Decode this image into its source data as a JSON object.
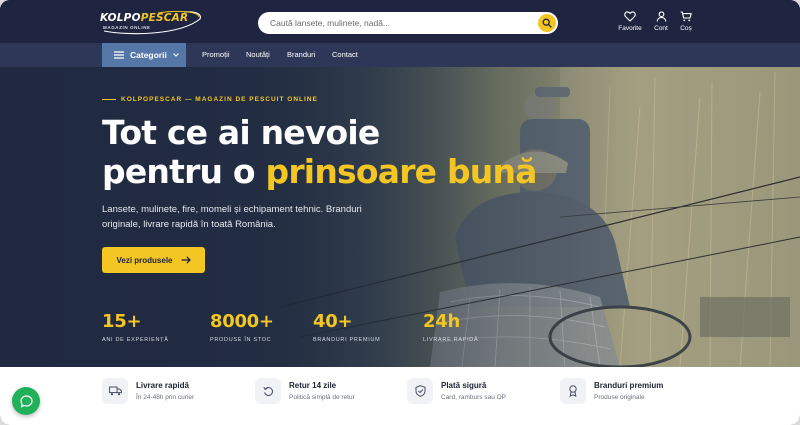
{
  "header": {
    "logo": {
      "name": "KOLPOPESCAR",
      "name_main": "KOLPO",
      "name_accent": "PESCAR",
      "tagline": "MAGAZIN ONLINE"
    },
    "search": {
      "placeholder": "Caută lansete, mulinete, nadă...",
      "icon": "search-icon"
    },
    "actions": [
      {
        "label": "Favorite",
        "icon": "heart-icon"
      },
      {
        "label": "Cont",
        "icon": "user-icon"
      },
      {
        "label": "Coș",
        "icon": "cart-icon"
      }
    ]
  },
  "nav": {
    "categories_label": "Categorii",
    "links": [
      "Promoții",
      "Noutăți",
      "Branduri",
      "Contact"
    ]
  },
  "hero": {
    "eyebrow": "KOLPOPESCAR — MAGAZIN DE PESCUIT ONLINE",
    "headline_line1": "Tot ce ai nevoie",
    "headline_line2_prefix": "pentru o",
    "headline_accent": "prinsoare bună",
    "subtitle": "Lansete, mulinete, fire, momeli și echipament tehnic. Branduri originale, livrare rapidă în toată România.",
    "cta_label": "Vezi produsele",
    "stats": [
      {
        "value": "15+",
        "label": "ANI DE EXPERIENȚĂ"
      },
      {
        "value": "8000+",
        "label": "PRODUSE ÎN STOC"
      },
      {
        "value": "40+",
        "label": "BRANDURI PREMIUM"
      },
      {
        "value": "24h",
        "label": "LIVRARE RAPIDĂ"
      }
    ]
  },
  "features": [
    {
      "title": "Livrare rapidă",
      "desc": "În 24-48h prin curier",
      "icon": "truck-icon"
    },
    {
      "title": "Retur 14 zile",
      "desc": "Politică simplă de retur",
      "icon": "return-icon"
    },
    {
      "title": "Plată sigură",
      "desc": "Card, ramburs sau OP",
      "icon": "shield-check-icon"
    },
    {
      "title": "Branduri premium",
      "desc": "Produse originale",
      "icon": "badge-icon"
    }
  ],
  "colors": {
    "header_bg": "#1f2540",
    "nav_bg": "#2e3758",
    "category_button": "#5477a7",
    "accent": "#f3c623",
    "chat_button": "#21b15a"
  }
}
